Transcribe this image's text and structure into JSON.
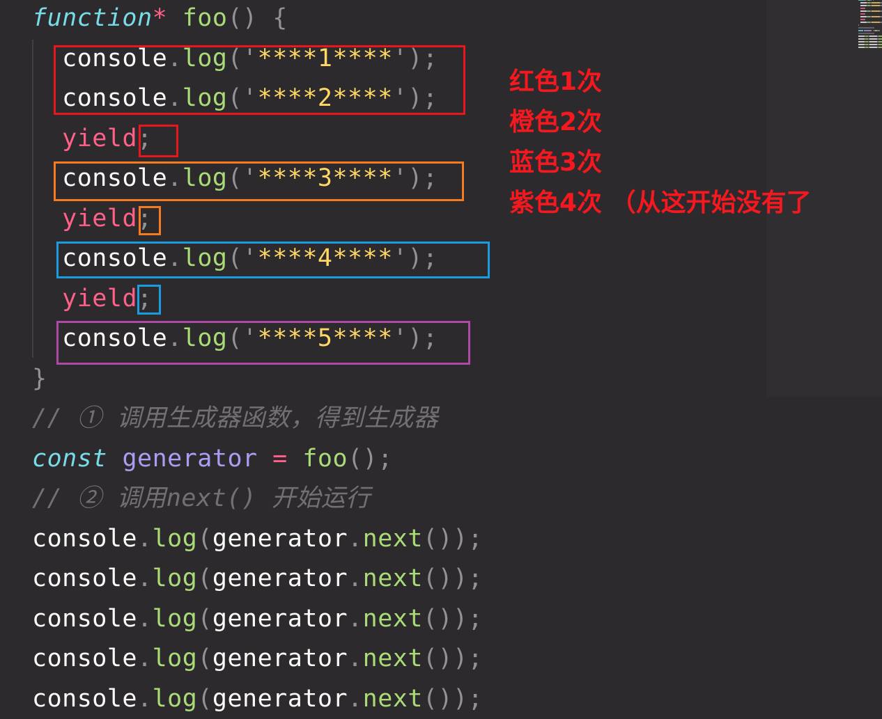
{
  "editor": {
    "background": "#2d2a2e",
    "palette": {
      "plain": "#fcfcfa",
      "punct": "#939293",
      "keyword": "#78dce8",
      "storage": "#ff6188",
      "func": "#a9dc76",
      "string": "#ffd866",
      "variable": "#ab9df2",
      "comment": "#727072"
    },
    "lines": [
      {
        "tokens": [
          {
            "text": "function",
            "kind": "keyword"
          },
          {
            "text": "*",
            "kind": "storage"
          },
          {
            "text": " ",
            "kind": "ws"
          },
          {
            "text": "foo",
            "kind": "func"
          },
          {
            "text": "()",
            "kind": "punct"
          },
          {
            "text": " ",
            "kind": "ws"
          },
          {
            "text": "{",
            "kind": "punct"
          }
        ]
      },
      {
        "tokens": [
          {
            "text": "  ",
            "kind": "ws"
          },
          {
            "text": "console",
            "kind": "plain"
          },
          {
            "text": ".",
            "kind": "punct"
          },
          {
            "text": "log",
            "kind": "func"
          },
          {
            "text": "('",
            "kind": "punct"
          },
          {
            "text": "****1****",
            "kind": "string"
          },
          {
            "text": "');",
            "kind": "punct"
          }
        ]
      },
      {
        "tokens": [
          {
            "text": "  ",
            "kind": "ws"
          },
          {
            "text": "console",
            "kind": "plain"
          },
          {
            "text": ".",
            "kind": "punct"
          },
          {
            "text": "log",
            "kind": "func"
          },
          {
            "text": "('",
            "kind": "punct"
          },
          {
            "text": "****2****",
            "kind": "string"
          },
          {
            "text": "');",
            "kind": "punct"
          }
        ]
      },
      {
        "tokens": [
          {
            "text": "  ",
            "kind": "ws"
          },
          {
            "text": "yield",
            "kind": "storage"
          },
          {
            "text": ";",
            "kind": "punct"
          }
        ]
      },
      {
        "tokens": [
          {
            "text": "  ",
            "kind": "ws"
          },
          {
            "text": "console",
            "kind": "plain"
          },
          {
            "text": ".",
            "kind": "punct"
          },
          {
            "text": "log",
            "kind": "func"
          },
          {
            "text": "('",
            "kind": "punct"
          },
          {
            "text": "****3****",
            "kind": "string"
          },
          {
            "text": "');",
            "kind": "punct"
          }
        ]
      },
      {
        "tokens": [
          {
            "text": "  ",
            "kind": "ws"
          },
          {
            "text": "yield",
            "kind": "storage"
          },
          {
            "text": ";",
            "kind": "punct"
          }
        ]
      },
      {
        "tokens": [
          {
            "text": "  ",
            "kind": "ws"
          },
          {
            "text": "console",
            "kind": "plain"
          },
          {
            "text": ".",
            "kind": "punct"
          },
          {
            "text": "log",
            "kind": "func"
          },
          {
            "text": "('",
            "kind": "punct"
          },
          {
            "text": "****4****",
            "kind": "string"
          },
          {
            "text": "');",
            "kind": "punct"
          }
        ]
      },
      {
        "tokens": [
          {
            "text": "  ",
            "kind": "ws"
          },
          {
            "text": "yield",
            "kind": "storage"
          },
          {
            "text": ";",
            "kind": "punct"
          }
        ]
      },
      {
        "tokens": [
          {
            "text": "  ",
            "kind": "ws"
          },
          {
            "text": "console",
            "kind": "plain"
          },
          {
            "text": ".",
            "kind": "punct"
          },
          {
            "text": "log",
            "kind": "func"
          },
          {
            "text": "('",
            "kind": "punct"
          },
          {
            "text": "****5****",
            "kind": "string"
          },
          {
            "text": "');",
            "kind": "punct"
          }
        ]
      },
      {
        "tokens": [
          {
            "text": "}",
            "kind": "punct"
          }
        ]
      },
      {
        "tokens": [
          {
            "text": "// ① 调用生成器函数，得到生成器",
            "kind": "comment"
          }
        ]
      },
      {
        "tokens": [
          {
            "text": "const",
            "kind": "keyword"
          },
          {
            "text": " ",
            "kind": "ws"
          },
          {
            "text": "generator",
            "kind": "variable"
          },
          {
            "text": " ",
            "kind": "ws"
          },
          {
            "text": "=",
            "kind": "storage"
          },
          {
            "text": " ",
            "kind": "ws"
          },
          {
            "text": "foo",
            "kind": "func"
          },
          {
            "text": "();",
            "kind": "punct"
          }
        ]
      },
      {
        "tokens": [
          {
            "text": "// ② 调用next() 开始运行",
            "kind": "comment"
          }
        ]
      },
      {
        "tokens": [
          {
            "text": "console",
            "kind": "plain"
          },
          {
            "text": ".",
            "kind": "punct"
          },
          {
            "text": "log",
            "kind": "func"
          },
          {
            "text": "(",
            "kind": "punct"
          },
          {
            "text": "generator",
            "kind": "plain"
          },
          {
            "text": ".",
            "kind": "punct"
          },
          {
            "text": "next",
            "kind": "func"
          },
          {
            "text": "());",
            "kind": "punct"
          }
        ]
      },
      {
        "tokens": [
          {
            "text": "console",
            "kind": "plain"
          },
          {
            "text": ".",
            "kind": "punct"
          },
          {
            "text": "log",
            "kind": "func"
          },
          {
            "text": "(",
            "kind": "punct"
          },
          {
            "text": "generator",
            "kind": "plain"
          },
          {
            "text": ".",
            "kind": "punct"
          },
          {
            "text": "next",
            "kind": "func"
          },
          {
            "text": "());",
            "kind": "punct"
          }
        ]
      },
      {
        "tokens": [
          {
            "text": "console",
            "kind": "plain"
          },
          {
            "text": ".",
            "kind": "punct"
          },
          {
            "text": "log",
            "kind": "func"
          },
          {
            "text": "(",
            "kind": "punct"
          },
          {
            "text": "generator",
            "kind": "plain"
          },
          {
            "text": ".",
            "kind": "punct"
          },
          {
            "text": "next",
            "kind": "func"
          },
          {
            "text": "());",
            "kind": "punct"
          }
        ]
      },
      {
        "tokens": [
          {
            "text": "console",
            "kind": "plain"
          },
          {
            "text": ".",
            "kind": "punct"
          },
          {
            "text": "log",
            "kind": "func"
          },
          {
            "text": "(",
            "kind": "punct"
          },
          {
            "text": "generator",
            "kind": "plain"
          },
          {
            "text": ".",
            "kind": "punct"
          },
          {
            "text": "next",
            "kind": "func"
          },
          {
            "text": "());",
            "kind": "punct"
          }
        ]
      },
      {
        "tokens": [
          {
            "text": "console",
            "kind": "plain"
          },
          {
            "text": ".",
            "kind": "punct"
          },
          {
            "text": "log",
            "kind": "func"
          },
          {
            "text": "(",
            "kind": "punct"
          },
          {
            "text": "generator",
            "kind": "plain"
          },
          {
            "text": ".",
            "kind": "punct"
          },
          {
            "text": "next",
            "kind": "func"
          },
          {
            "text": "());",
            "kind": "punct"
          }
        ]
      }
    ]
  },
  "highlights": {
    "red": "#e8161d",
    "orange": "#f47b20",
    "blue": "#1a9ce0",
    "purple": "#ae4aa5"
  },
  "annotations": {
    "color": "#f5191f",
    "notes": [
      "红色1次",
      "橙色2次",
      "蓝色3次",
      "紫色4次 （从这开始没有了"
    ]
  }
}
